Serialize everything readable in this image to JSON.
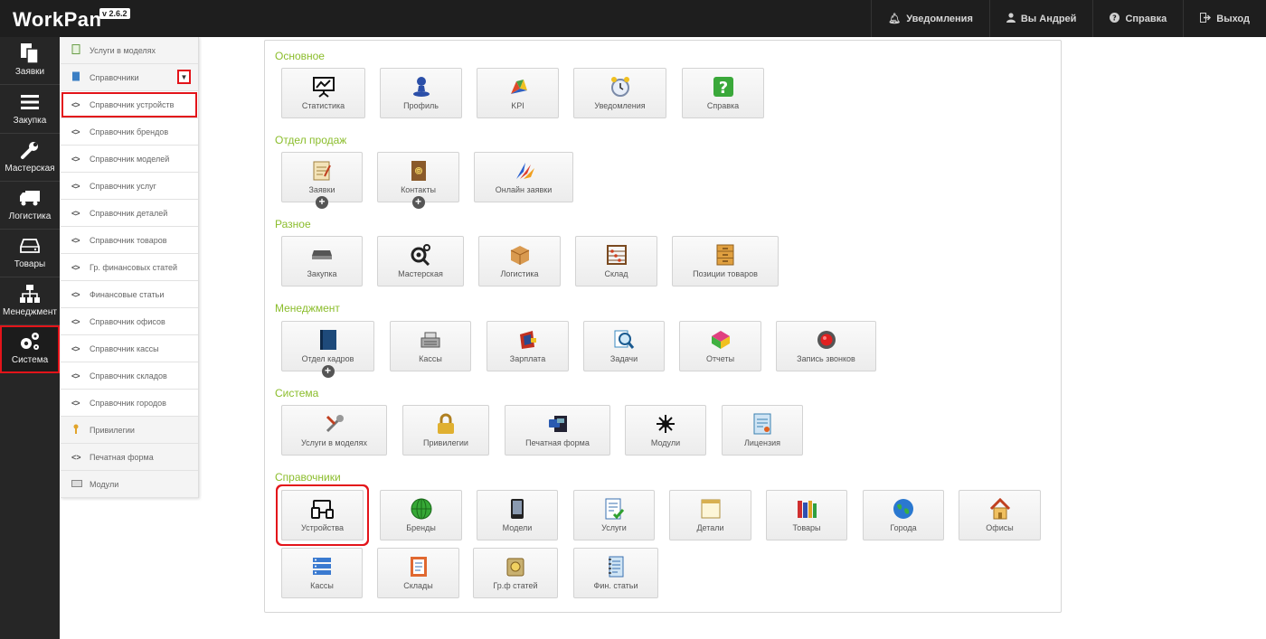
{
  "app": {
    "logo": "WorkPan",
    "version": "v 2.6.2"
  },
  "topnav": {
    "notifications": "Уведомления",
    "user": "Вы Андрей",
    "help": "Справка",
    "logout": "Выход"
  },
  "sidebar": {
    "items": [
      {
        "label": "Заявки",
        "icon": "document-copy-icon"
      },
      {
        "label": "Закупка",
        "icon": "menu-lines-icon"
      },
      {
        "label": "Мастерская",
        "icon": "wrench-icon"
      },
      {
        "label": "Логистика",
        "icon": "truck-icon"
      },
      {
        "label": "Товары",
        "icon": "drive-icon"
      },
      {
        "label": "Менеджмент",
        "icon": "hierarchy-icon"
      },
      {
        "label": "Система",
        "icon": "gears-icon"
      }
    ]
  },
  "submenu": {
    "items": [
      {
        "label": "Услуги в моделях"
      },
      {
        "label": "Справочники"
      },
      {
        "label": "Справочник устройств"
      },
      {
        "label": "Справочник брендов"
      },
      {
        "label": "Справочник моделей"
      },
      {
        "label": "Справочник услуг"
      },
      {
        "label": "Справочник деталей"
      },
      {
        "label": "Справочник товаров"
      },
      {
        "label": "Гр. финансовых статей"
      },
      {
        "label": "Финансовые статьи"
      },
      {
        "label": "Справочник офисов"
      },
      {
        "label": "Справочник кассы"
      },
      {
        "label": "Справочник складов"
      },
      {
        "label": "Справочник городов"
      },
      {
        "label": "Привилегии"
      },
      {
        "label": "Печатная форма"
      },
      {
        "label": "Модули"
      }
    ]
  },
  "sections": [
    {
      "title": "Основное",
      "tiles": [
        {
          "label": "Статистика"
        },
        {
          "label": "Профиль"
        },
        {
          "label": "KPI"
        },
        {
          "label": "Уведомления"
        },
        {
          "label": "Справка"
        }
      ]
    },
    {
      "title": "Отдел продаж",
      "tiles": [
        {
          "label": "Заявки"
        },
        {
          "label": "Контакты"
        },
        {
          "label": "Онлайн заявки"
        }
      ]
    },
    {
      "title": "Разное",
      "tiles": [
        {
          "label": "Закупка"
        },
        {
          "label": "Мастерская"
        },
        {
          "label": "Логистика"
        },
        {
          "label": "Склад"
        },
        {
          "label": "Позиции товаров"
        }
      ]
    },
    {
      "title": "Менеджмент",
      "tiles": [
        {
          "label": "Отдел кадров"
        },
        {
          "label": "Кассы"
        },
        {
          "label": "Зарплата"
        },
        {
          "label": "Задачи"
        },
        {
          "label": "Отчеты"
        },
        {
          "label": "Запись звонков"
        }
      ]
    },
    {
      "title": "Система",
      "tiles": [
        {
          "label": "Услуги в моделях"
        },
        {
          "label": "Привилегии"
        },
        {
          "label": "Печатная форма"
        },
        {
          "label": "Модули"
        },
        {
          "label": "Лицензия"
        }
      ]
    },
    {
      "title": "Справочники",
      "tiles": [
        {
          "label": "Устройства"
        },
        {
          "label": "Бренды"
        },
        {
          "label": "Модели"
        },
        {
          "label": "Услуги"
        },
        {
          "label": "Детали"
        },
        {
          "label": "Товары"
        },
        {
          "label": "Города"
        },
        {
          "label": "Офисы"
        },
        {
          "label": "Кассы"
        },
        {
          "label": "Склады"
        },
        {
          "label": "Гр.ф статей"
        },
        {
          "label": "Фин. статьи"
        }
      ]
    }
  ],
  "colors": {
    "accent_green": "#8bbd2c",
    "highlight_red": "#e3141a",
    "topbar": "#1e1e1e",
    "sidebar": "#262626"
  }
}
